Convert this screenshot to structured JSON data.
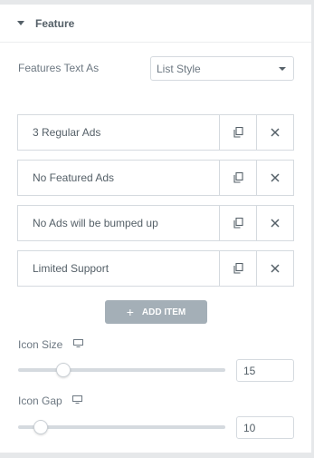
{
  "section": {
    "title": "Feature"
  },
  "features_text_as": {
    "label": "Features Text As",
    "value": "List Style"
  },
  "items": [
    {
      "title": "3 Regular Ads"
    },
    {
      "title": "No Featured Ads"
    },
    {
      "title": "No Ads will be bumped up"
    },
    {
      "title": "Limited Support"
    }
  ],
  "add_item": {
    "label": "ADD ITEM",
    "icon": "plus-icon"
  },
  "icon_size": {
    "label": "Icon Size",
    "value": "15",
    "level_fraction": 0.22,
    "device_icon": "desktop-icon"
  },
  "icon_gap": {
    "label": "Icon Gap",
    "value": "10",
    "level_fraction": 0.11,
    "device_icon": "desktop-icon"
  },
  "colors": {
    "add_button": "#a4afb7",
    "border": "#d5dadf",
    "text": "#6d7882",
    "heading": "#556068"
  }
}
